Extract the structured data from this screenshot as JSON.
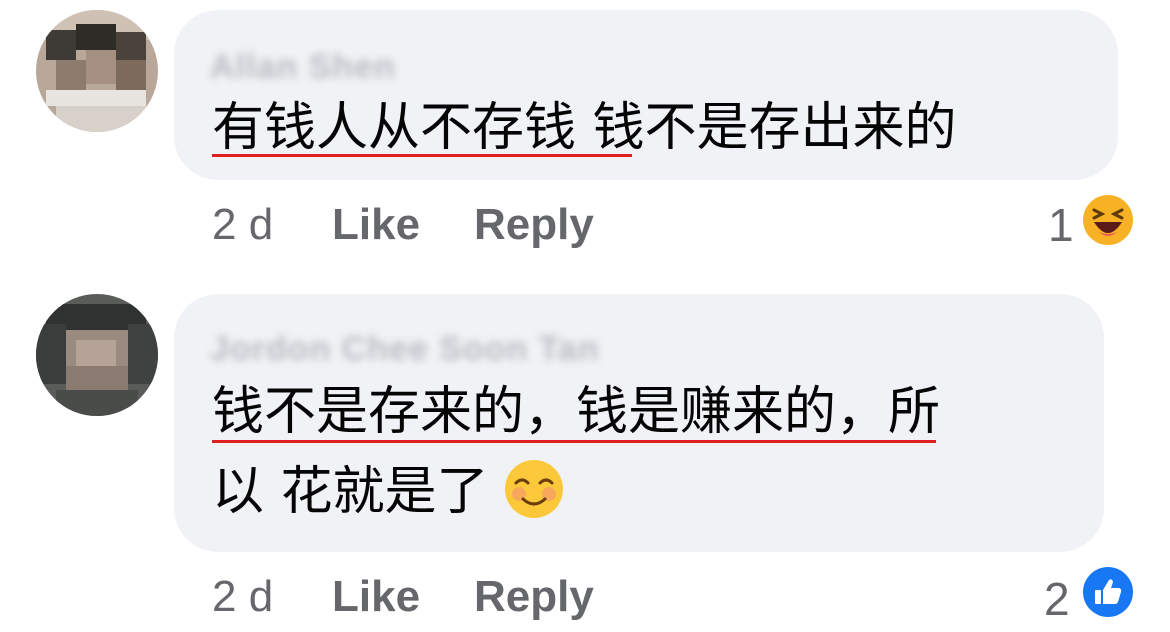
{
  "comments": [
    {
      "author": "Allan Shen",
      "text_lines": [
        "有钱人从不存钱 钱不是存出来的"
      ],
      "time": "2 d",
      "like_label": "Like",
      "reply_label": "Reply",
      "reaction_count": "1",
      "reaction_icon": "haha-icon"
    },
    {
      "author": "Jordon Chee Soon Tan",
      "text_lines": [
        "钱不是存来的，钱是赚来的，所",
        "以 花就是了"
      ],
      "inline_emoji": "smiling-blush-emoji",
      "time": "2 d",
      "like_label": "Like",
      "reply_label": "Reply",
      "reaction_count": "2",
      "reaction_icon": "like-icon"
    }
  ],
  "colors": {
    "bubble": "#f0f2f5",
    "meta_text": "#65676b",
    "underline": "#e02020",
    "like_blue": "#1877f2",
    "haha_yellow": "#f7b125"
  }
}
